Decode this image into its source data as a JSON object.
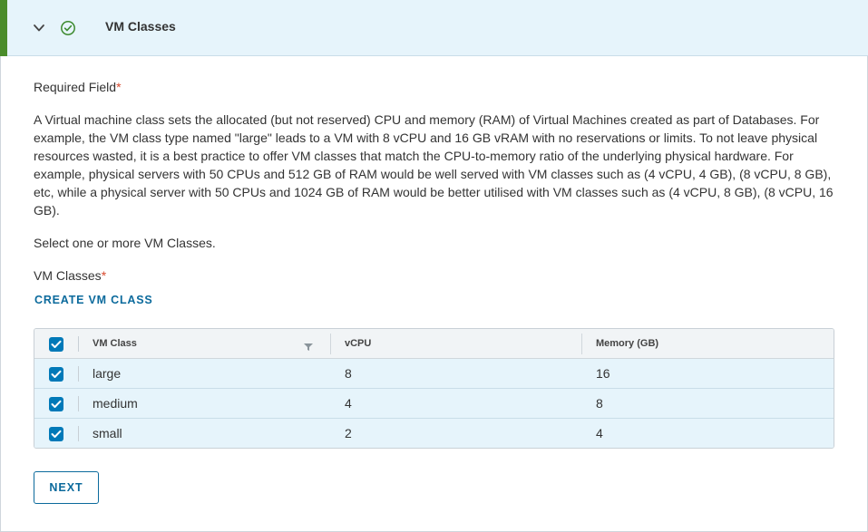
{
  "step": {
    "title": "VM Classes",
    "status_icon": "check-circle-icon",
    "toggle_icon": "chevron-down-icon",
    "accent_color": "#4a8c2a"
  },
  "form": {
    "required_label": "Required Field",
    "required_marker": "*",
    "description": "A Virtual machine class sets the allocated (but not reserved) CPU and memory (RAM) of Virtual Machines created as part of Databases. For example, the VM class type named \"large\" leads to a VM with 8 vCPU and 16 GB vRAM with no reservations or limits. To not leave physical resources wasted, it is a best practice to offer VM classes that match the CPU-to-memory ratio of the underlying physical hardware. For example, physical servers with 50 CPUs and 512 GB of RAM would be well served with VM classes such as (4 vCPU, 4 GB), (8 vCPU, 8 GB), etc, while a physical server with 50 CPUs and 1024 GB of RAM would be better utilised with VM classes such as (4 vCPU, 8 GB), (8 vCPU, 16 GB).",
    "select_prompt": "Select one or more VM Classes.",
    "vm_classes_label": "VM Classes",
    "create_link": "CREATE VM CLASS"
  },
  "table": {
    "headers": [
      "VM Class",
      "vCPU",
      "Memory (GB)"
    ],
    "select_all_checked": true,
    "rows": [
      {
        "name": "large",
        "vcpu": "8",
        "memory": "16",
        "checked": true
      },
      {
        "name": "medium",
        "vcpu": "4",
        "memory": "8",
        "checked": true
      },
      {
        "name": "small",
        "vcpu": "2",
        "memory": "4",
        "checked": true
      }
    ]
  },
  "actions": {
    "next_label": "NEXT"
  },
  "colors": {
    "primary": "#0079b8",
    "link": "#0b6a9c",
    "selected_row": "#e6f4fb",
    "required_star": "#d84a2e"
  }
}
